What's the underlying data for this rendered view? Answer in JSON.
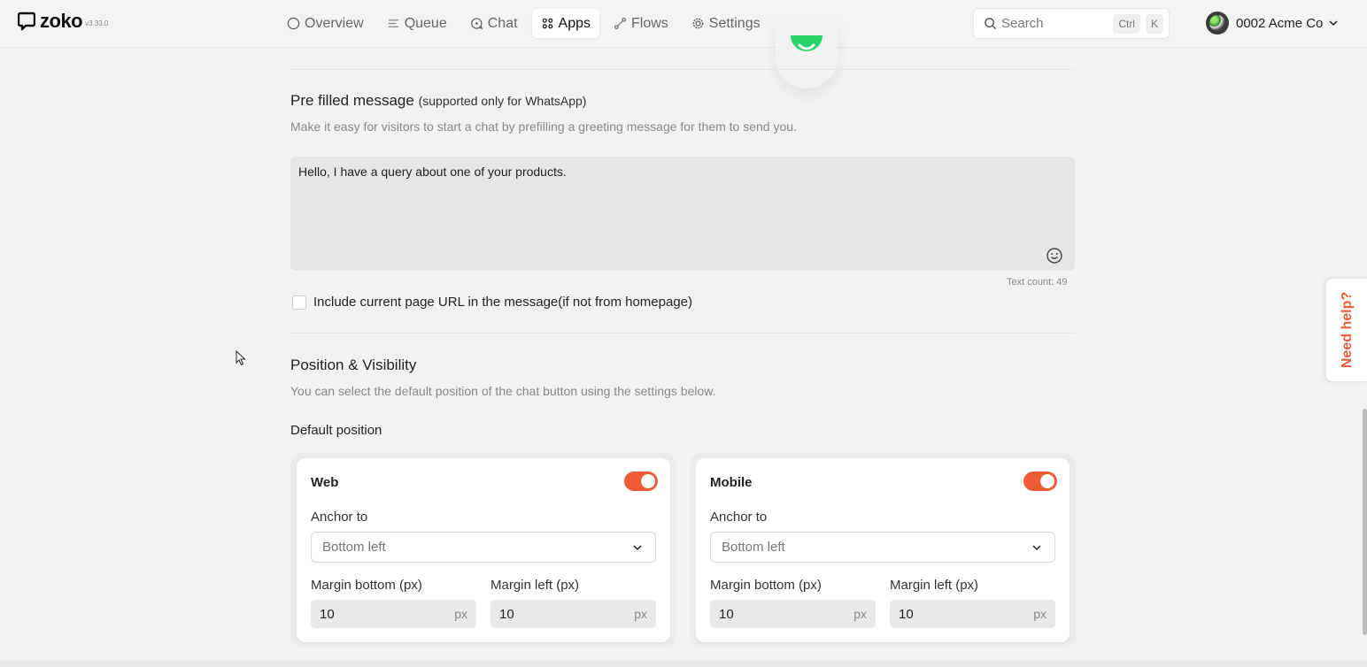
{
  "app": {
    "name": "zoko",
    "version": "v3.33.0"
  },
  "nav": {
    "items": [
      {
        "label": "Overview",
        "icon": "circle-icon"
      },
      {
        "label": "Queue",
        "icon": "queue-icon"
      },
      {
        "label": "Chat",
        "icon": "chat-icon"
      },
      {
        "label": "Apps",
        "icon": "apps-grid-icon",
        "active": true
      },
      {
        "label": "Flows",
        "icon": "flows-icon"
      },
      {
        "label": "Settings",
        "icon": "gear-icon"
      }
    ]
  },
  "search": {
    "label": "Search",
    "shortcut_key1": "Ctrl",
    "shortcut_key2": "K"
  },
  "account": {
    "name": "0002 Acme Co"
  },
  "prefill": {
    "title": "Pre filled message",
    "title_note": "(supported only for WhatsApp)",
    "description": "Make it easy for visitors to start a chat by prefilling a greeting message for them to send you.",
    "message": "Hello, I have a query about one of your products.",
    "text_count": "Text count: 49",
    "include_url_label": "Include current page URL in the message(if not from homepage)"
  },
  "position": {
    "title": "Position & Visibility",
    "description": "You can select the default position of the chat button using the settings below.",
    "default_position_label": "Default position",
    "cards": [
      {
        "title": "Web",
        "enabled": true,
        "anchor_label": "Anchor to",
        "anchor_value": "Bottom left",
        "margin_bottom_label": "Margin bottom (px)",
        "margin_bottom_value": "10",
        "margin_left_label": "Margin left (px)",
        "margin_left_value": "10",
        "unit": "px"
      },
      {
        "title": "Mobile",
        "enabled": true,
        "anchor_label": "Anchor to",
        "anchor_value": "Bottom left",
        "margin_bottom_label": "Margin bottom (px)",
        "margin_bottom_value": "10",
        "margin_left_label": "Margin left (px)",
        "margin_left_value": "10",
        "unit": "px"
      }
    ]
  },
  "help": {
    "label": "Need help?"
  },
  "colors": {
    "accent": "#ef5b34",
    "whatsapp": "#25d366"
  }
}
